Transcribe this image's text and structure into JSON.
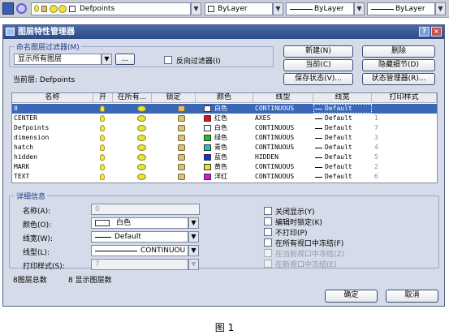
{
  "toolbar": {
    "layer_name": "Defpoints",
    "color": "ByLayer",
    "linetype": "ByLayer",
    "lineweight": "ByLayer"
  },
  "dialog": {
    "title": "图层特性管理器",
    "help_glyph": "?",
    "close_glyph": "×"
  },
  "filter": {
    "group_label": "命名图层过滤器(M)",
    "selected": "显示所有图层",
    "more_button": "...",
    "invert_label": "反向过滤器(I)"
  },
  "current_layer": {
    "label": "当前层: Defpoints"
  },
  "buttons": {
    "new": "新建(N)",
    "delete": "删除",
    "current": "当前(C)",
    "hide_details": "隐藏细节(D)",
    "save_state": "保存状态(V)...",
    "state_manager": "状态管理器(R)..."
  },
  "table": {
    "columns": [
      "名称",
      "开",
      "在所有...",
      "锁定",
      "颜色",
      "线型",
      "线宽",
      "打印样式"
    ],
    "rows": [
      {
        "name": "0",
        "color_name": "白色",
        "color_hex": "#ffffff",
        "linetype": "CONTINUOUS",
        "lineweight": "Default",
        "plot_style": "",
        "selected": true
      },
      {
        "name": "CENTER",
        "color_name": "红色",
        "color_hex": "#e01010",
        "linetype": "AXES",
        "lineweight": "Default",
        "plot_style": "1",
        "selected": false
      },
      {
        "name": "Defpoints",
        "color_name": "白色",
        "color_hex": "#ffffff",
        "linetype": "CONTINUOUS",
        "lineweight": "Default",
        "plot_style": "7",
        "selected": false
      },
      {
        "name": "dimension",
        "color_name": "绿色",
        "color_hex": "#18c818",
        "linetype": "CONTINUOUS",
        "lineweight": "Default",
        "plot_style": "3",
        "selected": false
      },
      {
        "name": "hatch",
        "color_name": "青色",
        "color_hex": "#10c8c8",
        "linetype": "CONTINUOUS",
        "lineweight": "Default",
        "plot_style": "4",
        "selected": false
      },
      {
        "name": "hidden",
        "color_name": "蓝色",
        "color_hex": "#1030e0",
        "linetype": "HIDDEN",
        "lineweight": "Default",
        "plot_style": "5",
        "selected": false
      },
      {
        "name": "MARK",
        "color_name": "黄色",
        "color_hex": "#f0e020",
        "linetype": "CONTINUOUS",
        "lineweight": "Default",
        "plot_style": "2",
        "selected": false
      },
      {
        "name": "TEXT",
        "color_name": "洋红",
        "color_hex": "#e010e0",
        "linetype": "CONTINUOUS",
        "lineweight": "Default",
        "plot_style": "6",
        "selected": false
      }
    ]
  },
  "details": {
    "group_label": "详细信息",
    "name_label": "名称(A):",
    "name_value": "0",
    "color_label": "颜色(O):",
    "color_value": "白色",
    "lineweight_label": "线宽(W):",
    "lineweight_value": "Default",
    "linetype_label": "线型(L):",
    "linetype_value": "CONTINUOU",
    "plotstyle_label": "打印样式(S):",
    "plotstyle_value": "7",
    "checks": [
      {
        "label": "关闭显示(Y)",
        "disabled": false
      },
      {
        "label": "编辑时锁定(K)",
        "disabled": false
      },
      {
        "label": "不打印(P)",
        "disabled": false
      },
      {
        "label": "在所有视口中冻结(F)",
        "disabled": false
      },
      {
        "label": "在当前视口中冻结(Z)",
        "disabled": true
      },
      {
        "label": "在新视口中冻结(E)",
        "disabled": true
      }
    ]
  },
  "status": {
    "total": "8图层总数",
    "shown": "8 显示图层数"
  },
  "footer": {
    "ok": "确定",
    "cancel": "取消"
  },
  "caption": "图 1"
}
